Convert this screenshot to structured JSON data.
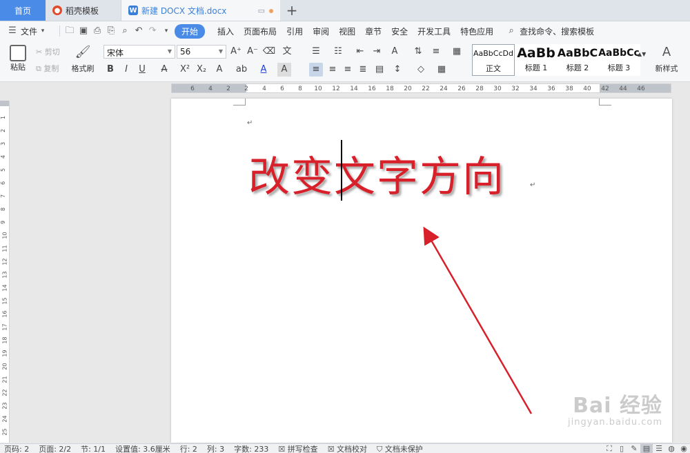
{
  "tabs": {
    "home": "首页",
    "templates": "稻壳模板",
    "doc": "新建 DOCX 文档.docx",
    "new_tab": "+"
  },
  "menubar": {
    "file": "文件",
    "tabs": [
      "开始",
      "插入",
      "页面布局",
      "引用",
      "审阅",
      "视图",
      "章节",
      "安全",
      "开发工具",
      "特色应用"
    ],
    "search": "查找命令、搜索模板"
  },
  "ribbon": {
    "paste": "粘贴",
    "cut": "剪切",
    "copy": "复制",
    "format_painter": "格式刷",
    "font_name": "宋体",
    "font_size": "56",
    "styles": [
      {
        "sample": "AaBbCcDd",
        "name": "正文"
      },
      {
        "sample": "AaBb",
        "name": "标题 1"
      },
      {
        "sample": "AaBbC",
        "name": "标题 2"
      },
      {
        "sample": "AaBbCc",
        "name": "标题 3"
      }
    ],
    "new_style": "新样式"
  },
  "ruler": {
    "h_numbers": [
      "6",
      "4",
      "2",
      "2",
      "4",
      "6",
      "8",
      "10",
      "12",
      "14",
      "16",
      "18",
      "20",
      "22",
      "24",
      "26",
      "28",
      "30",
      "32",
      "34",
      "36",
      "38",
      "40",
      "42",
      "44",
      "46"
    ],
    "v_numbers": [
      "1",
      "2",
      "3",
      "4",
      "5",
      "6",
      "7",
      "8",
      "9",
      "10",
      "11",
      "12",
      "13",
      "14",
      "15",
      "16",
      "17",
      "18",
      "19",
      "20",
      "21",
      "22",
      "23",
      "24",
      "25"
    ]
  },
  "document": {
    "text": "改变文字方向"
  },
  "watermark": {
    "logo": "Bai  经验",
    "url": "jingyan.baidu.com"
  },
  "statusbar": {
    "items": [
      "页码: 2",
      "页面: 2/2",
      "节: 1/1",
      "设置值: 3.6厘米",
      "行: 2",
      "列: 3",
      "字数: 233",
      "拼写检查",
      "文档校对",
      "文档未保护"
    ]
  },
  "colors": {
    "accent": "#4a8be8",
    "doc_text": "#d8202a",
    "arrow": "#d8202a"
  }
}
